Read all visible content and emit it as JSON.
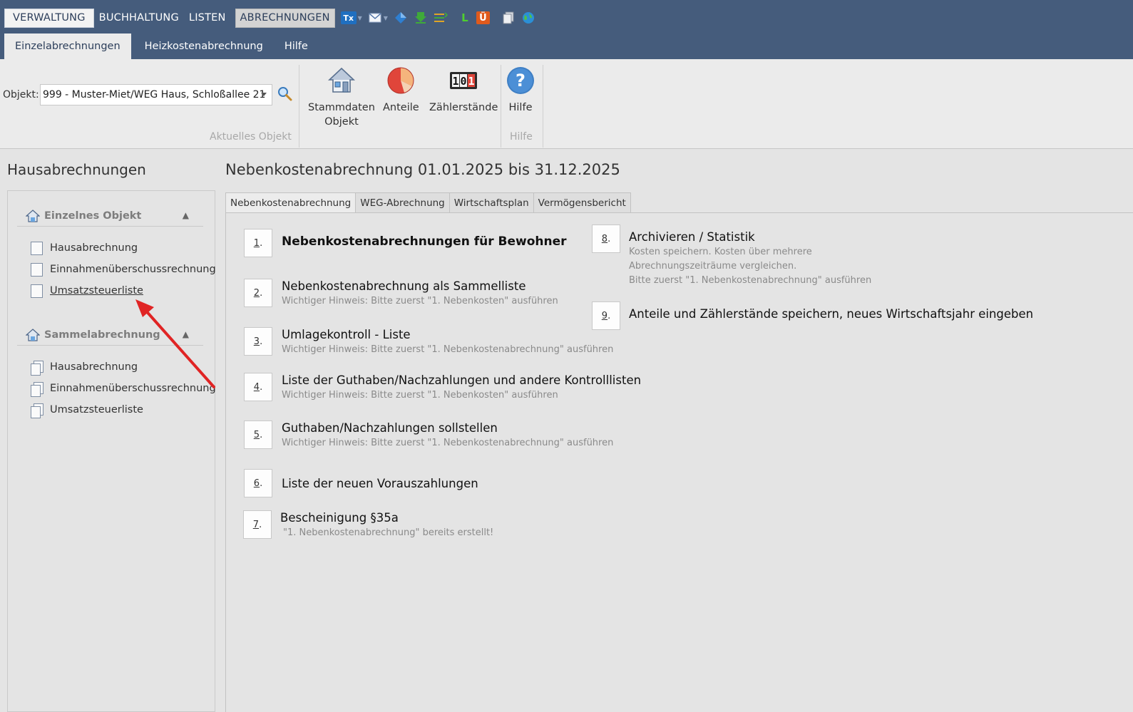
{
  "menu": {
    "items": [
      "VERWALTUNG",
      "BUCHHALTUNG",
      "LISTEN",
      "ABRECHNUNGEN"
    ],
    "icons": [
      "tx-icon",
      "mail-icon",
      "diamond-icon",
      "download-icon",
      "list-icon",
      "l-icon",
      "ue-icon",
      "copy-icon",
      "globe-icon"
    ],
    "tx_label": "Tx",
    "l_label": "L",
    "ue_label": "Ü"
  },
  "tabs": [
    "Einzelabrechnungen",
    "Heizkostenabrechnung",
    "Hilfe"
  ],
  "ribbon": {
    "object_label": "Objekt:",
    "object_value": "999 - Muster-Miet/WEG Haus, Schloßallee 21",
    "buttons": [
      {
        "label_line1": "Stammdaten",
        "label_line2": "Objekt",
        "icon": "house-icon"
      },
      {
        "label_line1": "Anteile",
        "label_line2": "",
        "icon": "pie-chart-icon"
      },
      {
        "label_line1": "Zählerstände",
        "label_line2": "",
        "icon": "counter-icon"
      },
      {
        "label_line1": "Hilfe",
        "label_line2": "",
        "icon": "help-icon"
      }
    ],
    "counter_text": "101",
    "group_current": "Aktuelles Objekt",
    "group_help": "Hilfe"
  },
  "left": {
    "title": "Hausabrechnungen",
    "groups": [
      {
        "label": "Einzelnes Objekt",
        "items": [
          "Hausabrechnung",
          "Einnahmenüberschussrechnung",
          "Umsatzsteuerliste"
        ]
      },
      {
        "label": "Sammelabrechnung",
        "items": [
          "Hausabrechnung",
          "Einnahmenüberschussrechnung",
          "Umsatzsteuerliste"
        ]
      }
    ]
  },
  "main": {
    "title": "Nebenkostenabrechnung 01.01.2025 bis 31.12.2025",
    "tabs": [
      "Nebenkostenabrechnung",
      "WEG-Abrechnung",
      "Wirtschaftsplan",
      "Vermögensbericht"
    ],
    "steps": [
      {
        "num": "1",
        "title": "Nebenkostenabrechnungen für Bewohner",
        "sub": ""
      },
      {
        "num": "2",
        "title": "Nebenkostenabrechnung als Sammelliste",
        "sub": "Wichtiger Hinweis: Bitte zuerst \"1. Nebenkosten\" ausführen"
      },
      {
        "num": "3",
        "title": "Umlagekontroll - Liste",
        "sub": "Wichtiger Hinweis: Bitte zuerst \"1. Nebenkostenabrechnung\" ausführen"
      },
      {
        "num": "4",
        "title": "Liste der Guthaben/Nachzahlungen und andere Kontrolllisten",
        "sub": "Wichtiger Hinweis: Bitte zuerst \"1. Nebenkosten\" ausführen"
      },
      {
        "num": "5",
        "title": "Guthaben/Nachzahlungen sollstellen",
        "sub": "Wichtiger Hinweis: Bitte zuerst \"1. Nebenkostenabrechnung\" ausführen"
      },
      {
        "num": "6",
        "title": "Liste der neuen Vorauszahlungen",
        "sub": ""
      },
      {
        "num": "7",
        "title": "Bescheinigung §35a",
        "sub": "\"1. Nebenkostenabrechnung\" bereits erstellt!"
      },
      {
        "num": "8",
        "title": "Archivieren / Statistik",
        "sub1": "Kosten speichern. Kosten über mehrere",
        "sub2": "Abrechnungszeiträume vergleichen.",
        "sub3": "Bitte zuerst \"1. Nebenkostenabrechnung\" ausführen"
      },
      {
        "num": "9",
        "title": "Anteile und Zählerstände speichern, neues Wirtschaftsjahr eingeben",
        "sub": ""
      }
    ]
  },
  "colors": {
    "topbar": "#455c7c",
    "ribbon": "#ebebeb",
    "background": "#e4e4e4",
    "annotation_arrow": "#e02424"
  }
}
